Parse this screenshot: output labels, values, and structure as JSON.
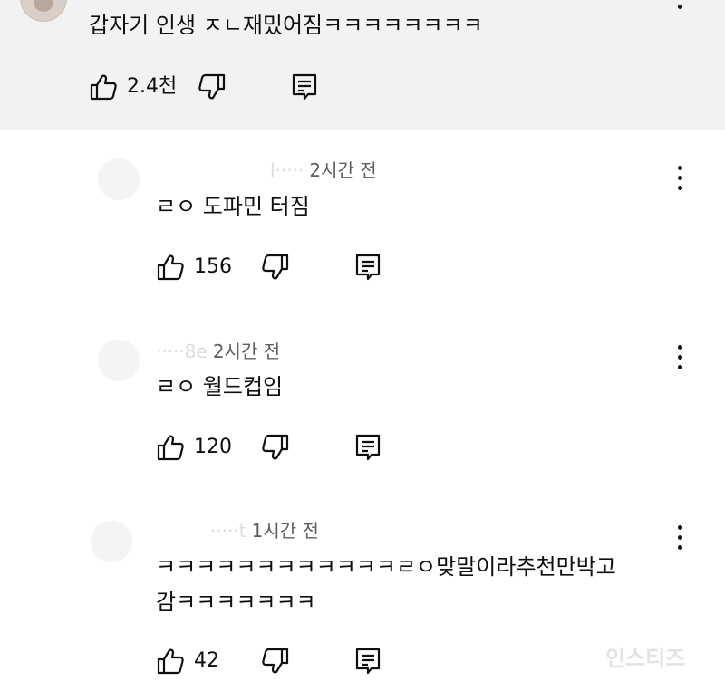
{
  "top_comment": {
    "text": "갑자기 인생 ㅈㄴ재밌어짐ㅋㅋㅋㅋㅋㅋㅋㅋ",
    "like_count": "2.4천"
  },
  "replies": [
    {
      "author": "l·····",
      "time": "2시간 전",
      "text_lines": [
        "ㄹㅇ 도파민 터짐"
      ],
      "like_count": "156"
    },
    {
      "author": "·····8e",
      "time": "2시간 전",
      "text_lines": [
        "ㄹㅇ 월드컵임"
      ],
      "like_count": "120"
    },
    {
      "author": "·····t",
      "time": "1시간 전",
      "text_lines": [
        "ㅋㅋㅋㅋㅋㅋㅋㅋㅋㅋㅋㅋㄹㅇ맞말이라추천만박고",
        "감ㅋㅋㅋㅋㅋㅋㅋ"
      ],
      "like_count": "42"
    }
  ],
  "watermark": "인스티즈",
  "icons": {
    "like": "thumbs-up-icon",
    "dislike": "thumbs-down-icon",
    "reply": "reply-icon",
    "menu": "more-vert-icon"
  }
}
